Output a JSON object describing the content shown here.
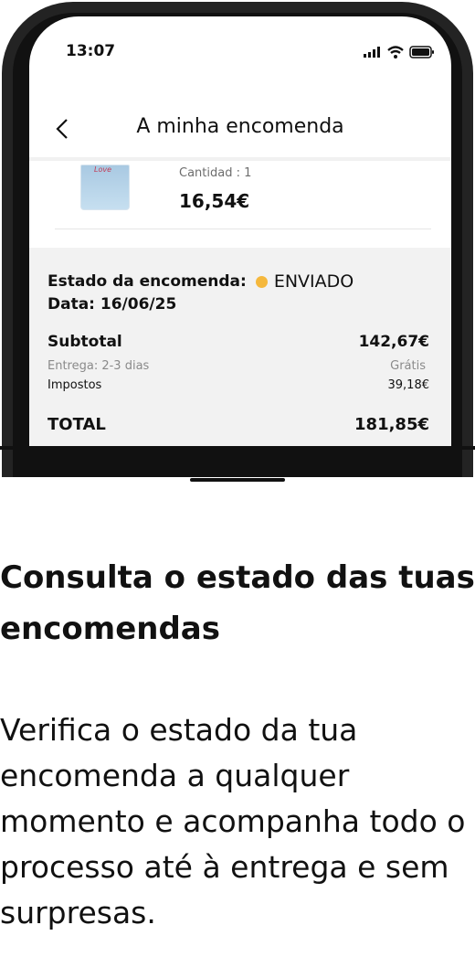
{
  "status_bar": {
    "time": "13:07"
  },
  "header": {
    "title": "A minha encomenda"
  },
  "item": {
    "brand": "Love",
    "quantity": "Cantidad : 1",
    "price": "16,54€"
  },
  "order": {
    "status_label": "Estado da encomenda:",
    "status_value": "ENVIADO",
    "status_color": "#f5b83d",
    "date": "Data: 16/06/25",
    "subtotal_label": "Subtotal",
    "subtotal_value": "142,67€",
    "delivery_label": "Entrega: 2-3 dias",
    "delivery_value": "Grátis",
    "tax_label": "Impostos",
    "tax_value": "39,18€",
    "total_label": "TOTAL",
    "total_value": "181,85€"
  },
  "promo": {
    "headline": "Consulta o estado das tuas encomendas",
    "description": "Verifica o estado da tua encomenda a qualquer momento e acompanha todo o processo até à entrega e sem surpresas."
  }
}
